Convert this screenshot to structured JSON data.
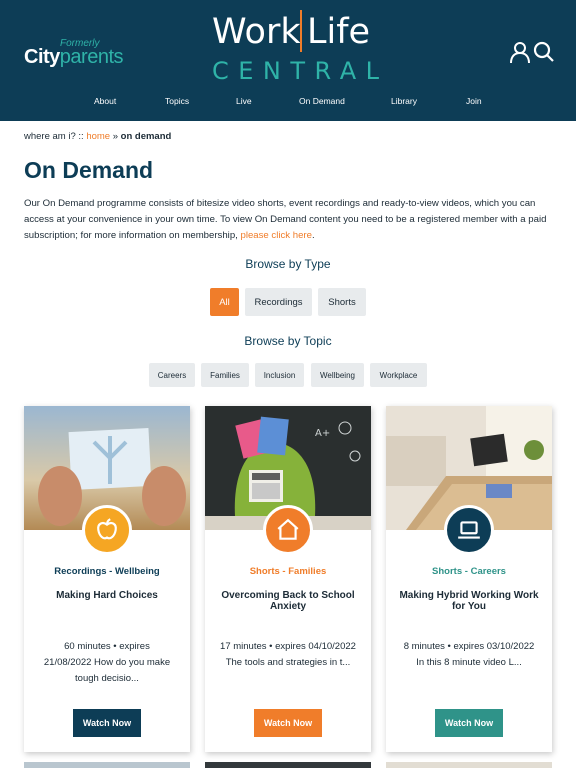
{
  "brand": {
    "formerly": "Formerly",
    "name_a": "City",
    "name_b": "parents"
  },
  "logo": {
    "word1": "Work",
    "word2": "Life",
    "word3": "CENTRAL"
  },
  "nav": [
    "About",
    "Topics",
    "Live",
    "On Demand",
    "Library",
    "Join"
  ],
  "breadcrumb": {
    "prefix": "where am i? :: ",
    "home": "home",
    "sep": " » ",
    "current": "on demand"
  },
  "page": {
    "title": "On Demand",
    "intro": "Our On Demand programme consists of bitesize video shorts, event recordings and ready-to-view videos, which you can access at your convenience in your own time. To view On Demand content you need to be a registered member with a paid subscription; for more information on membership, ",
    "intro_link": "please click here",
    "intro_end": "."
  },
  "browse_type": {
    "heading": "Browse by Type",
    "options": [
      "All",
      "Recordings",
      "Shorts"
    ],
    "selected": "All"
  },
  "browse_topic": {
    "heading": "Browse by Topic",
    "options": [
      "Careers",
      "Families",
      "Inclusion",
      "Wellbeing",
      "Workplace"
    ]
  },
  "cards": [
    {
      "type": "Recordings",
      "dash": " - ",
      "topic": "Wellbeing",
      "title": "Making Hard Choices",
      "meta1": "60 minutes • expires",
      "meta2": "21/08/2022 How do you make",
      "meta3": "tough decisio...",
      "button": "Watch Now",
      "color": "#0d3d56",
      "badge_color": "#f5a623",
      "icon": "apple-icon"
    },
    {
      "type": "Shorts",
      "dash": " - ",
      "topic": "Families",
      "title": "Overcoming Back to School Anxiety",
      "meta1": "17 minutes • expires 04/10/2022",
      "meta2": "The tools and strategies in t...",
      "meta3": "",
      "button": "Watch Now",
      "color": "#f07d2a",
      "badge_color": "#f07d2a",
      "icon": "house-icon"
    },
    {
      "type": "Shorts",
      "dash": " - ",
      "topic": "Careers",
      "title": "Making Hybrid Working Work for You",
      "meta1": "8 minutes • expires 03/10/2022",
      "meta2": "In this 8 minute video L...",
      "meta3": "",
      "button": "Watch Now",
      "color": "#2f9389",
      "badge_color": "#0d3d56",
      "icon": "laptop-icon"
    }
  ]
}
